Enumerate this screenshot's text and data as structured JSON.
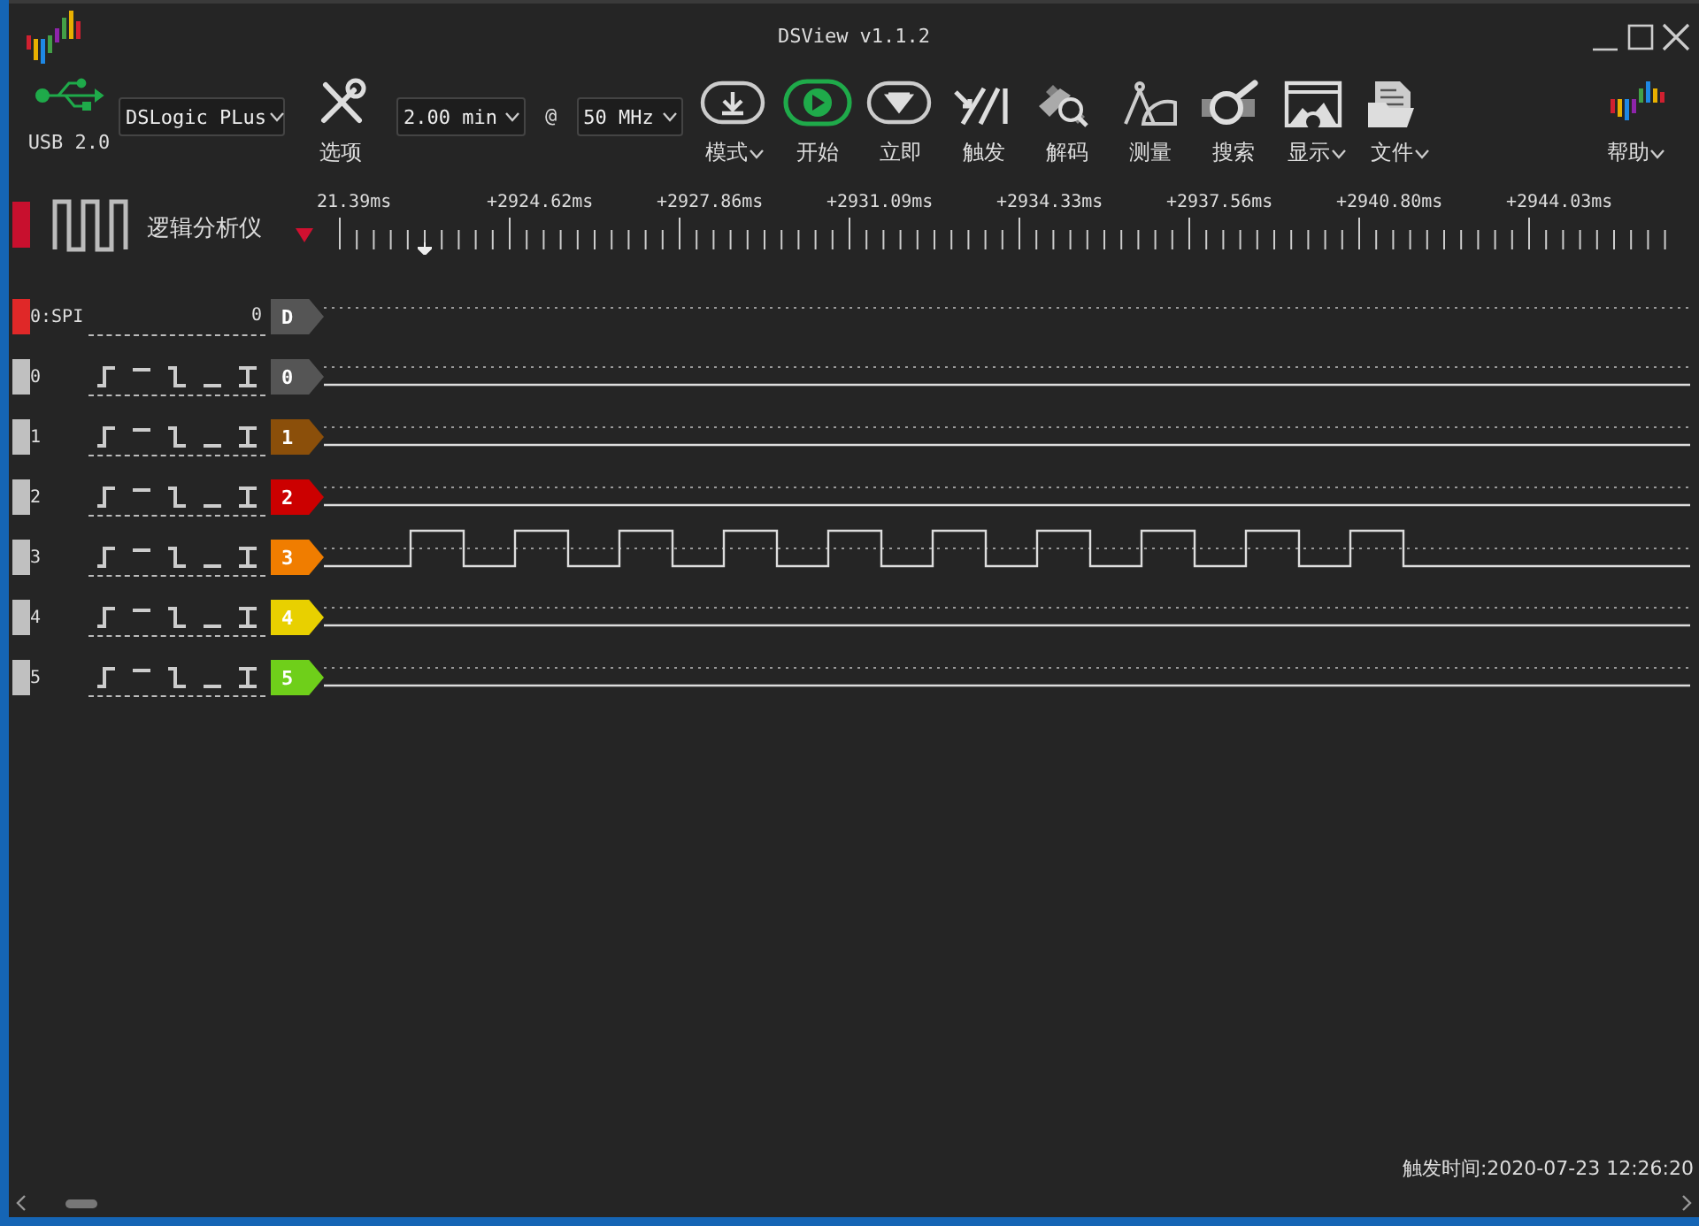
{
  "window": {
    "title": "DSView v1.1.2"
  },
  "toolbar": {
    "usb_label": "USB 2.0",
    "device": "DSLogic PLus",
    "options_label": "选项",
    "duration": "2.00 min",
    "at": "@",
    "rate": "50 MHz",
    "buttons": [
      {
        "label": "模式",
        "kind": "mode",
        "dropdown": true
      },
      {
        "label": "开始",
        "kind": "start",
        "dropdown": false
      },
      {
        "label": "立即",
        "kind": "instant",
        "dropdown": false
      },
      {
        "label": "触发",
        "kind": "trigger",
        "dropdown": false
      },
      {
        "label": "解码",
        "kind": "decode",
        "dropdown": false
      },
      {
        "label": "测量",
        "kind": "measure",
        "dropdown": false
      },
      {
        "label": "搜索",
        "kind": "search",
        "dropdown": false
      },
      {
        "label": "显示",
        "kind": "display",
        "dropdown": true
      },
      {
        "label": "文件",
        "kind": "file",
        "dropdown": true
      }
    ],
    "help": {
      "label": "帮助",
      "dropdown": true
    }
  },
  "mode_panel": {
    "label": "逻辑分析仪"
  },
  "ruler": {
    "labels": [
      "21.39ms",
      "+2924.62ms",
      "+2927.86ms",
      "+2931.09ms",
      "+2934.33ms",
      "+2937.56ms",
      "+2940.80ms",
      "+2944.03ms"
    ]
  },
  "channels": [
    {
      "name": "0:SPI",
      "kind": "decoder",
      "value": "0",
      "tag": "D",
      "color": "#555555"
    },
    {
      "name": "0",
      "kind": "logic",
      "tag": "0",
      "color": "#555555",
      "active": false
    },
    {
      "name": "1",
      "kind": "logic",
      "tag": "1",
      "color": "#8b4f0a",
      "active": false
    },
    {
      "name": "2",
      "kind": "logic",
      "tag": "2",
      "color": "#cc0000",
      "active": false
    },
    {
      "name": "3",
      "kind": "logic",
      "tag": "3",
      "color": "#f07d00",
      "active": true
    },
    {
      "name": "4",
      "kind": "logic",
      "tag": "4",
      "color": "#e8d000",
      "active": false
    },
    {
      "name": "5",
      "kind": "logic",
      "tag": "5",
      "color": "#6fcf1a",
      "active": false
    }
  ],
  "status": {
    "trigger_time": "触发时间:2020-07-23 12:26:20"
  }
}
